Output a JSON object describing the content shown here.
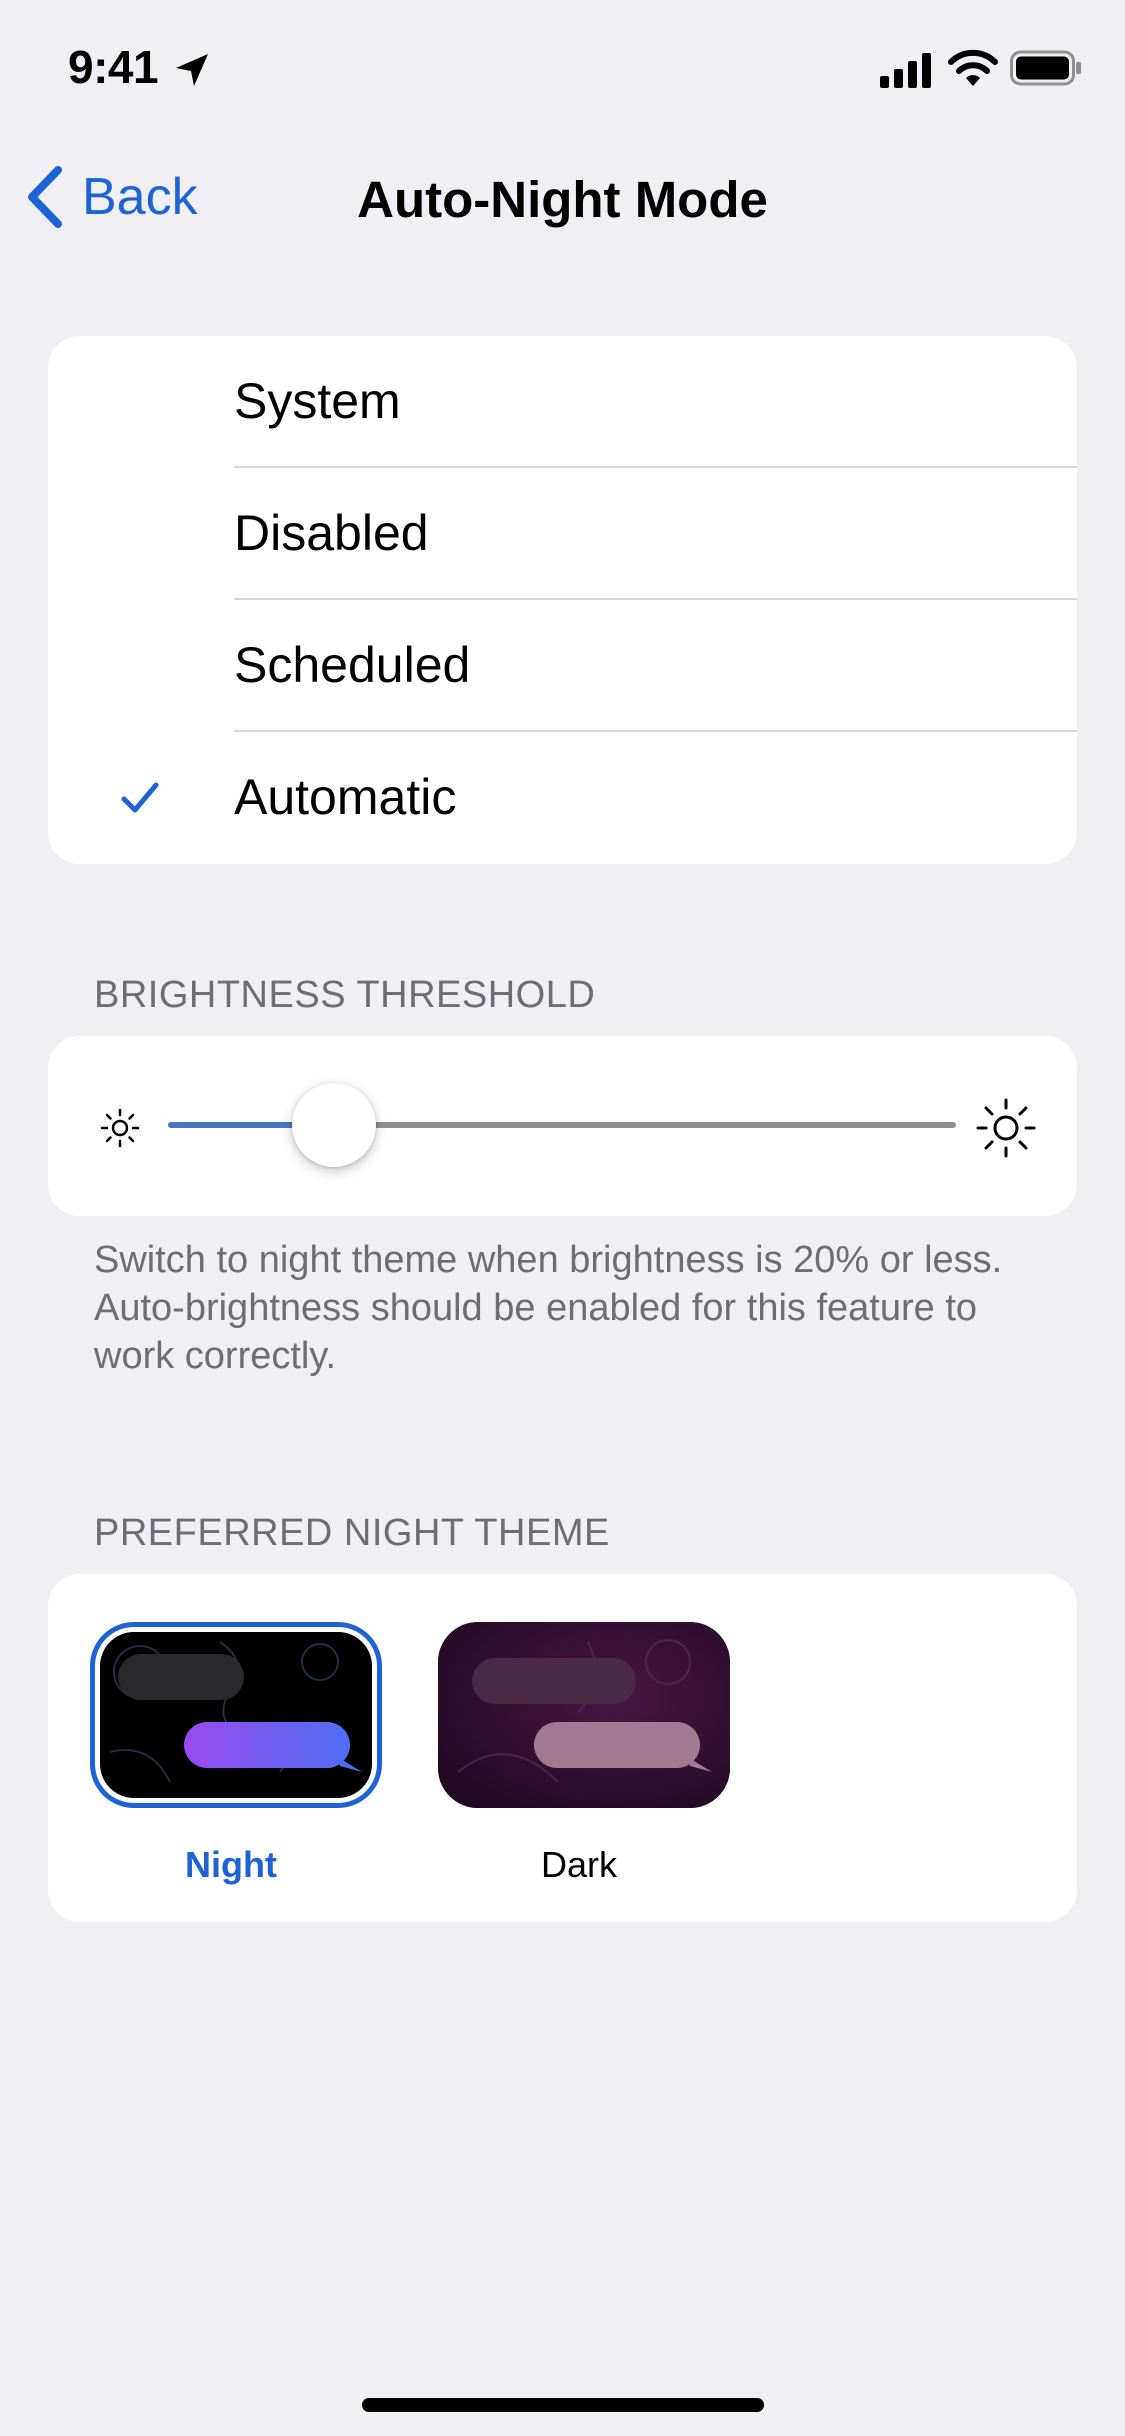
{
  "status_bar": {
    "time": "9:41"
  },
  "nav": {
    "back_label": "Back",
    "title": "Auto-Night Mode"
  },
  "modes": {
    "items": [
      {
        "label": "System",
        "selected": false
      },
      {
        "label": "Disabled",
        "selected": false
      },
      {
        "label": "Scheduled",
        "selected": false
      },
      {
        "label": "Automatic",
        "selected": true
      }
    ]
  },
  "brightness": {
    "header": "BRIGHTNESS THRESHOLD",
    "value_fraction": 0.2,
    "footer": "Switch to night theme when brightness is 20% or less. Auto-brightness should be enabled for this feature to work correctly."
  },
  "theme": {
    "header": "PREFERRED NIGHT THEME",
    "options": [
      {
        "label": "Night",
        "selected": true
      },
      {
        "label": "Dark",
        "selected": false
      }
    ]
  },
  "colors": {
    "accent": "#1d63d6",
    "background": "#efeff4",
    "secondary_text": "#6d6d72"
  }
}
